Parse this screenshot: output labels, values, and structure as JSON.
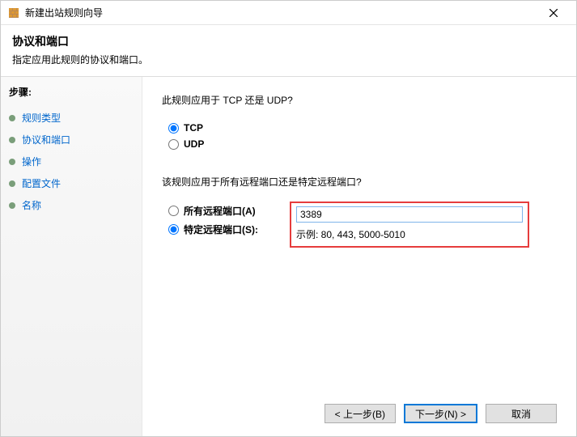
{
  "titlebar": {
    "title": "新建出站规则向导"
  },
  "header": {
    "title": "协议和端口",
    "subtitle": "指定应用此规则的协议和端口。"
  },
  "sidebar": {
    "header": "步骤:",
    "steps": [
      {
        "label": "规则类型"
      },
      {
        "label": "协议和端口"
      },
      {
        "label": "操作"
      },
      {
        "label": "配置文件"
      },
      {
        "label": "名称"
      }
    ]
  },
  "content": {
    "question1": "此规则应用于 TCP 还是 UDP?",
    "protocol": {
      "tcp_label": "TCP",
      "udp_label": "UDP",
      "selected": "tcp"
    },
    "question2": "该规则应用于所有远程端口还是特定远程端口?",
    "port_scope": {
      "all_label": "所有远程端口(A)",
      "specific_label": "特定远程端口(S):",
      "selected": "specific"
    },
    "port_input": {
      "value": "3389",
      "example": "示例: 80, 443, 5000-5010"
    }
  },
  "footer": {
    "back": "< 上一步(B)",
    "next": "下一步(N) >",
    "cancel": "取消"
  }
}
